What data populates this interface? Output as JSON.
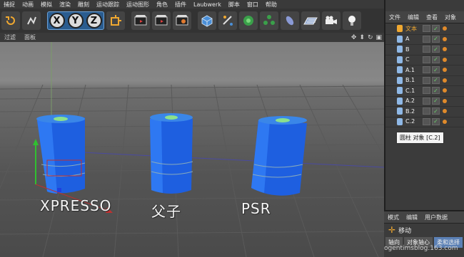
{
  "menubar": [
    "捕捉",
    "动画",
    "模拟",
    "渲染",
    "雕刻",
    "运动跟踪",
    "运动图形",
    "角色",
    "插件",
    "Laubwerk",
    "脚本",
    "窗口",
    "帮助"
  ],
  "toolbar": {
    "icons": [
      "undo-icon",
      "live-select-icon",
      "x-axis-lock",
      "y-axis-lock",
      "z-axis-lock",
      "coordinate-system-icon",
      "render-view-icon",
      "render-picture-viewer-icon",
      "render-settings-icon",
      "cube-icon",
      "pen-spline-icon",
      "subdivision-icon",
      "array-icon",
      "deformer-icon",
      "floor-icon",
      "camera-icon",
      "light-icon"
    ],
    "x_label": "X",
    "y_label": "Y",
    "z_label": "Z"
  },
  "viewport": {
    "menu": [
      "过滤",
      "面板"
    ],
    "labels": {
      "xpresso": "XPRESSO",
      "parent": "父子",
      "psr": "PSR"
    }
  },
  "object_manager": {
    "menu": [
      "文件",
      "编辑",
      "查看",
      "对象"
    ],
    "objects": [
      {
        "name": "文本",
        "icon": "text-object-icon",
        "color": "#f0a830"
      },
      {
        "name": "A",
        "icon": "cylinder-object-icon",
        "color": "#8fb8e6"
      },
      {
        "name": "B",
        "icon": "cylinder-object-icon",
        "color": "#8fb8e6"
      },
      {
        "name": "C",
        "icon": "cylinder-object-icon",
        "color": "#8fb8e6"
      },
      {
        "name": "A.1",
        "icon": "cylinder-object-icon",
        "color": "#8fb8e6"
      },
      {
        "name": "B.1",
        "icon": "cylinder-object-icon",
        "color": "#8fb8e6"
      },
      {
        "name": "C.1",
        "icon": "cylinder-object-icon",
        "color": "#8fb8e6"
      },
      {
        "name": "A.2",
        "icon": "cylinder-object-icon",
        "color": "#8fb8e6"
      },
      {
        "name": "B.2",
        "icon": "cylinder-object-icon",
        "color": "#8fb8e6"
      },
      {
        "name": "C.2",
        "icon": "cylinder-object-icon",
        "color": "#8fb8e6"
      }
    ],
    "tooltip": "圆柱 对象 [C.2]"
  },
  "attribute_manager": {
    "menu": [
      "模式",
      "编辑",
      "用户数据"
    ],
    "mode_title": "移动",
    "tabs": [
      "轴向",
      "对象轴心",
      "柔和选择"
    ]
  },
  "watermark": "ogentimsblog.163.com"
}
